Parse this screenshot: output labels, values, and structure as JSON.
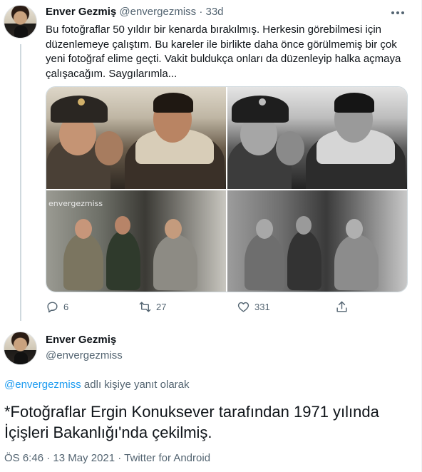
{
  "tweet1": {
    "author_name": "Enver Gezmiş",
    "author_handle": "@envergezmiss",
    "time": "· 33d",
    "text": "Bu fotoğraflar 50 yıldır bir kenarda bırakılmış. Herkesin görebilmesi için düzenlemeye çalıştım. Bu kareler ile birlikte daha önce görülmemiş bir çok yeni fotoğraf elime geçti. Vakit buldukça onları da düzenleyip halka açmaya çalışacağım. Saygılarımla...",
    "watermark": "envergezmiss",
    "reply_count": "6",
    "retweet_count": "27",
    "like_count": "331",
    "icons": [
      "more-icon",
      "reply-icon",
      "retweet-icon",
      "like-icon",
      "share-icon"
    ]
  },
  "tweet2": {
    "author_name": "Enver Gezmiş",
    "author_handle": "@envergezmiss",
    "reply_mention": "@envergezmiss",
    "reply_suffix": " adlı kişiye yanıt olarak",
    "text_line1": "*Fotoğraflar Ergin Konuksever tarafından 1971 yılında",
    "text_line2": "İçişleri Bakanlığı'nda çekilmiş.",
    "meta": "ÖS 6:46 · 13 May 2021 · Twitter for Android"
  },
  "colors": {
    "text": "#0f1419",
    "secondary": "#536471",
    "link": "#1d9bf0",
    "border": "#cfd9de"
  }
}
